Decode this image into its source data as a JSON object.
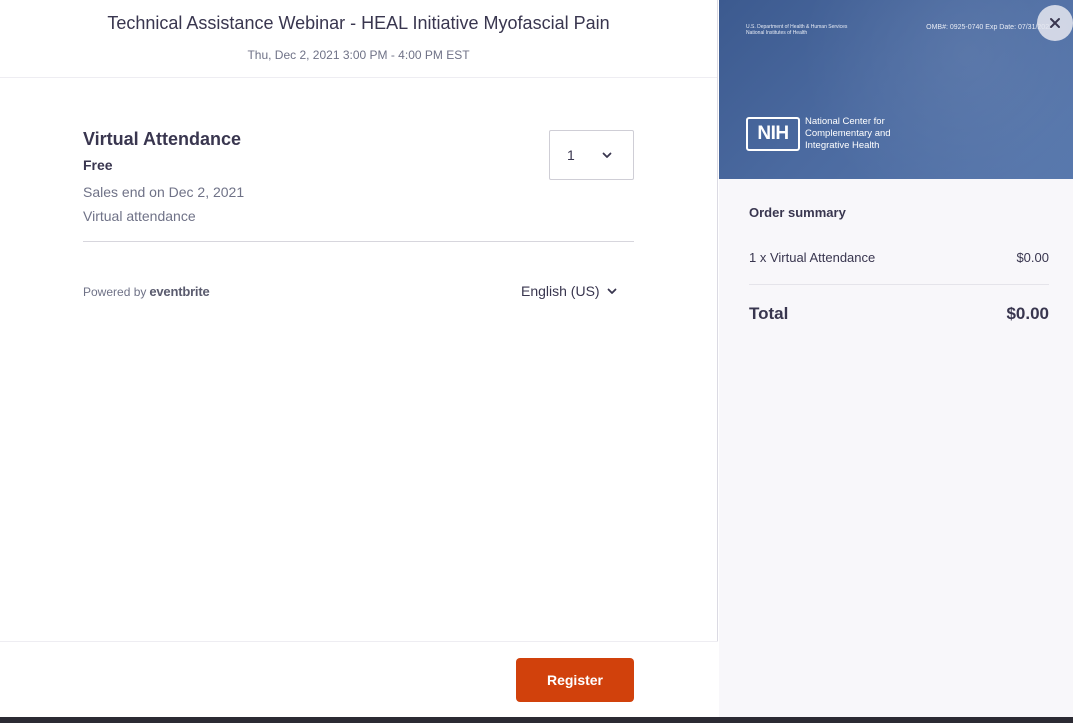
{
  "event": {
    "title": "Technical Assistance Webinar - HEAL Initiative Myofascial Pain",
    "date": "Thu, Dec 2, 2021 3:00 PM - 4:00 PM EST"
  },
  "ticket": {
    "name": "Virtual Attendance",
    "price": "Free",
    "sales_end": "Sales end on Dec 2, 2021",
    "description": "Virtual attendance",
    "quantity": "1"
  },
  "footer_info": {
    "powered_by": "Powered by",
    "brand": "eventbrite",
    "language": "English (US)"
  },
  "actions": {
    "register_label": "Register"
  },
  "banner": {
    "agency_line1": "U.S. Department of Health & Human Services",
    "agency_line2": "National Institutes of Health",
    "omb": "OMB#: 0925-0740 Exp Date: 07/31/2022",
    "nih_logo": "NIH",
    "center_line1": "National Center for",
    "center_line2": "Complementary and",
    "center_line3": "Integrative Health"
  },
  "summary": {
    "title": "Order summary",
    "item_label": "1 x Virtual Attendance",
    "item_price": "$0.00",
    "total_label": "Total",
    "total_value": "$0.00"
  },
  "colors": {
    "accent": "#d1410c",
    "text": "#39364f",
    "muted": "#6f7287",
    "banner": "#4b6aa0"
  },
  "icons": {
    "quantity_chevron": "chevron-down-icon",
    "language_chevron": "chevron-down-icon",
    "close": "close-icon"
  }
}
